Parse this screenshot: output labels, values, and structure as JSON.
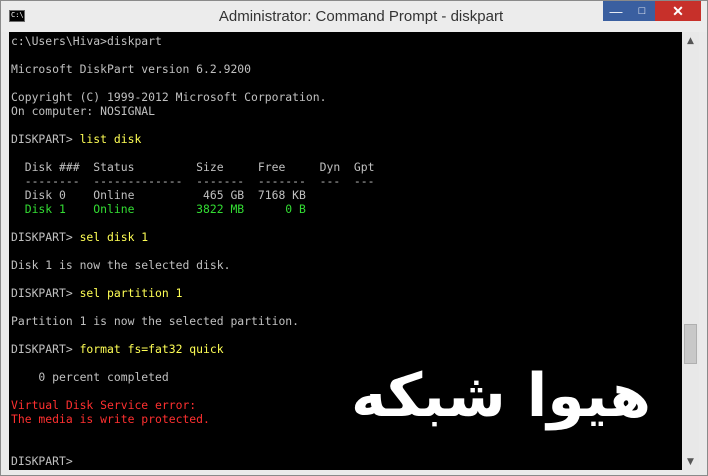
{
  "window": {
    "title": "Administrator: Command Prompt - diskpart",
    "icon_text": "C:\\",
    "minimize_glyph": "—",
    "maximize_glyph": "□",
    "close_glyph": "✕"
  },
  "console": {
    "lines": [
      "c:\\Users\\Hiva>diskpart",
      "Microsoft DiskPart version 6.2.9200",
      "Copyright (C) 1999-2012 Microsoft Corporation.",
      "On computer: NOSIGNAL",
      "DISKPART> ",
      "list disk",
      "  Disk ###  Status         Size     Free     Dyn  Gpt",
      "  --------  -------------  -------  -------  ---  ---",
      "  Disk 0    Online          465 GB  7168 KB",
      "  Disk 1    Online         3822 MB      0 B",
      "DISKPART> ",
      "sel disk 1",
      "Disk 1 is now the selected disk.",
      "DISKPART> ",
      "sel partition 1",
      "Partition 1 is now the selected partition.",
      "DISKPART> ",
      "format fs=fat32 quick",
      "    0 percent completed",
      "Virtual Disk Service error:",
      "The media is write protected.",
      "DISKPART>"
    ]
  },
  "watermark": {
    "text": "هیوا شبکه"
  },
  "scrollbar": {
    "up_glyph": "▲",
    "down_glyph": "▼"
  },
  "colors": {
    "console_bg": "#000000",
    "text": "#c0c0c0",
    "command": "#ffff55",
    "selected_disk": "#33dd33",
    "error": "#ff3030",
    "close_button": "#c7302a",
    "title_buttons": "#3a5fa0"
  }
}
